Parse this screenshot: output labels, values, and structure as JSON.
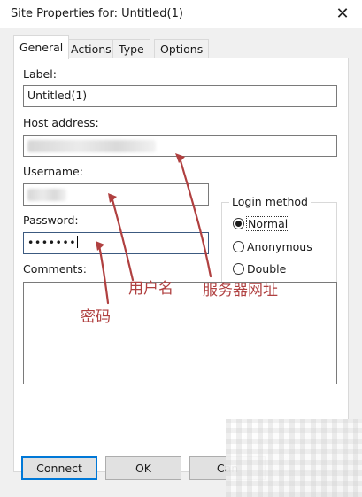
{
  "window": {
    "title": "Site Properties for: Untitled(1)",
    "close_glyph": "✕"
  },
  "tabs": [
    {
      "label": "General",
      "active": true
    },
    {
      "label": "Actions",
      "active": false
    },
    {
      "label": "Type",
      "active": false
    },
    {
      "label": "Options",
      "active": false
    }
  ],
  "form": {
    "label_caption": "Label:",
    "label_value": "Untitled(1)",
    "host_caption": "Host address:",
    "host_value": "",
    "username_caption": "Username:",
    "username_value": "",
    "password_caption": "Password:",
    "password_value": "•••••••",
    "comments_caption": "Comments:",
    "comments_value": ""
  },
  "login_method": {
    "title": "Login method",
    "options": [
      {
        "label": "Normal",
        "selected": true
      },
      {
        "label": "Anonymous",
        "selected": false
      },
      {
        "label": "Double",
        "selected": false
      }
    ]
  },
  "buttons": {
    "connect": "Connect",
    "ok": "OK",
    "cancel": "Can"
  },
  "annotations": {
    "host_note": "服务器网址",
    "username_note": "用户名",
    "password_note": "密码",
    "color": "#b04040"
  },
  "colors": {
    "dialog_bg": "#f0f0f0",
    "panel_bg": "#ffffff",
    "default_button_border": "#0078d7"
  }
}
